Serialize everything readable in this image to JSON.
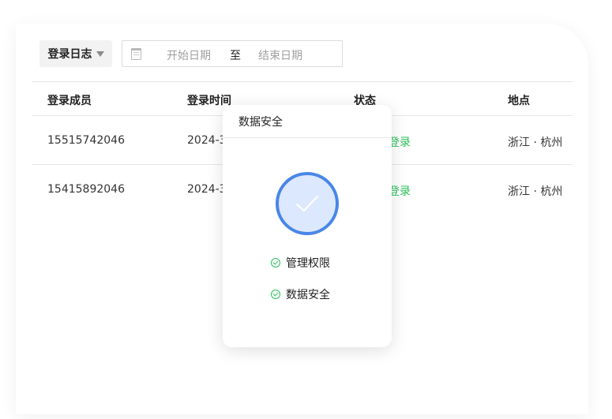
{
  "toolbar": {
    "log_label": "登录日志",
    "date_range": {
      "start_placeholder": "开始日期",
      "separator": "至",
      "end_placeholder": "结束日期"
    }
  },
  "table": {
    "headers": [
      "登录成员",
      "登录时间",
      "状态",
      "地点"
    ],
    "rows": [
      {
        "member": "15515742046",
        "time": "2024-3-",
        "status": "登录",
        "location": "浙江 · 杭州"
      },
      {
        "member": "15415892046",
        "time": "2024-3-",
        "status": "登录",
        "location": "浙江 · 杭州"
      }
    ]
  },
  "popover": {
    "title": "数据安全",
    "permissions": [
      "管理权限",
      "数据安全"
    ]
  },
  "colors": {
    "accent": "#4a86e8",
    "badge_fill": "#dce8fd",
    "success": "#2bbf59",
    "select_bg": "#f2f2f2"
  },
  "icons": [
    "caret-down-icon",
    "calendar-icon",
    "checkmark-badge-icon",
    "check-circle-icon"
  ]
}
